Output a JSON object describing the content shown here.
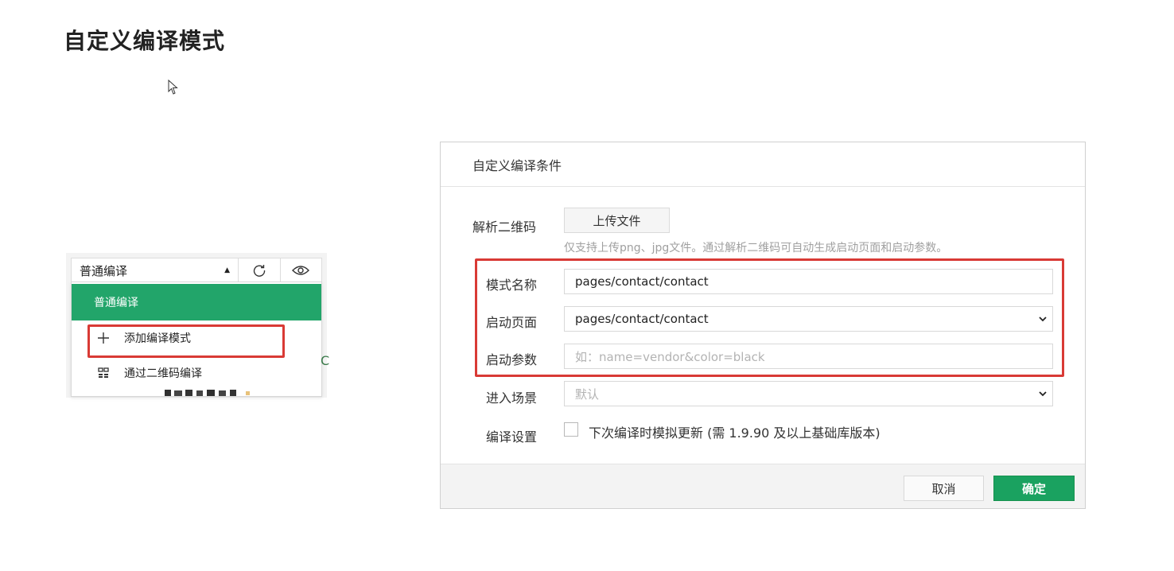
{
  "page": {
    "title": "自定义编译模式"
  },
  "toolbar": {
    "mode_label": "普通编译",
    "caret_icon": "caret-up-icon",
    "refresh_icon": "refresh-icon",
    "preview_icon": "eye-icon"
  },
  "dropdown": {
    "selected": "普通编译",
    "items": [
      {
        "label": "添加编译模式",
        "icon": "plus-icon"
      },
      {
        "label": "通过二维码编译",
        "icon": "qr-code-icon"
      }
    ]
  },
  "snippet": {
    "stray_char": "C"
  },
  "dialog": {
    "title": "自定义编译条件",
    "qr": {
      "label": "解析二维码",
      "upload_button": "上传文件",
      "hint": "仅支持上传png、jpg文件。通过解析二维码可自动生成启动页面和启动参数。"
    },
    "mode_name": {
      "label": "模式名称",
      "value": "pages/contact/contact"
    },
    "start_page": {
      "label": "启动页面",
      "value": "pages/contact/contact"
    },
    "start_params": {
      "label": "启动参数",
      "placeholder": "如：name=vendor&color=black"
    },
    "scene": {
      "label": "进入场景",
      "value": "默认"
    },
    "compile_settings": {
      "label": "编译设置",
      "checkbox_label": "下次编译时模拟更新 (需 1.9.90 及以上基础库版本)",
      "checked": false
    },
    "cancel": "取消",
    "ok": "确定"
  },
  "colors": {
    "accent_green": "#1aa260",
    "highlight_red": "#d93a35"
  }
}
